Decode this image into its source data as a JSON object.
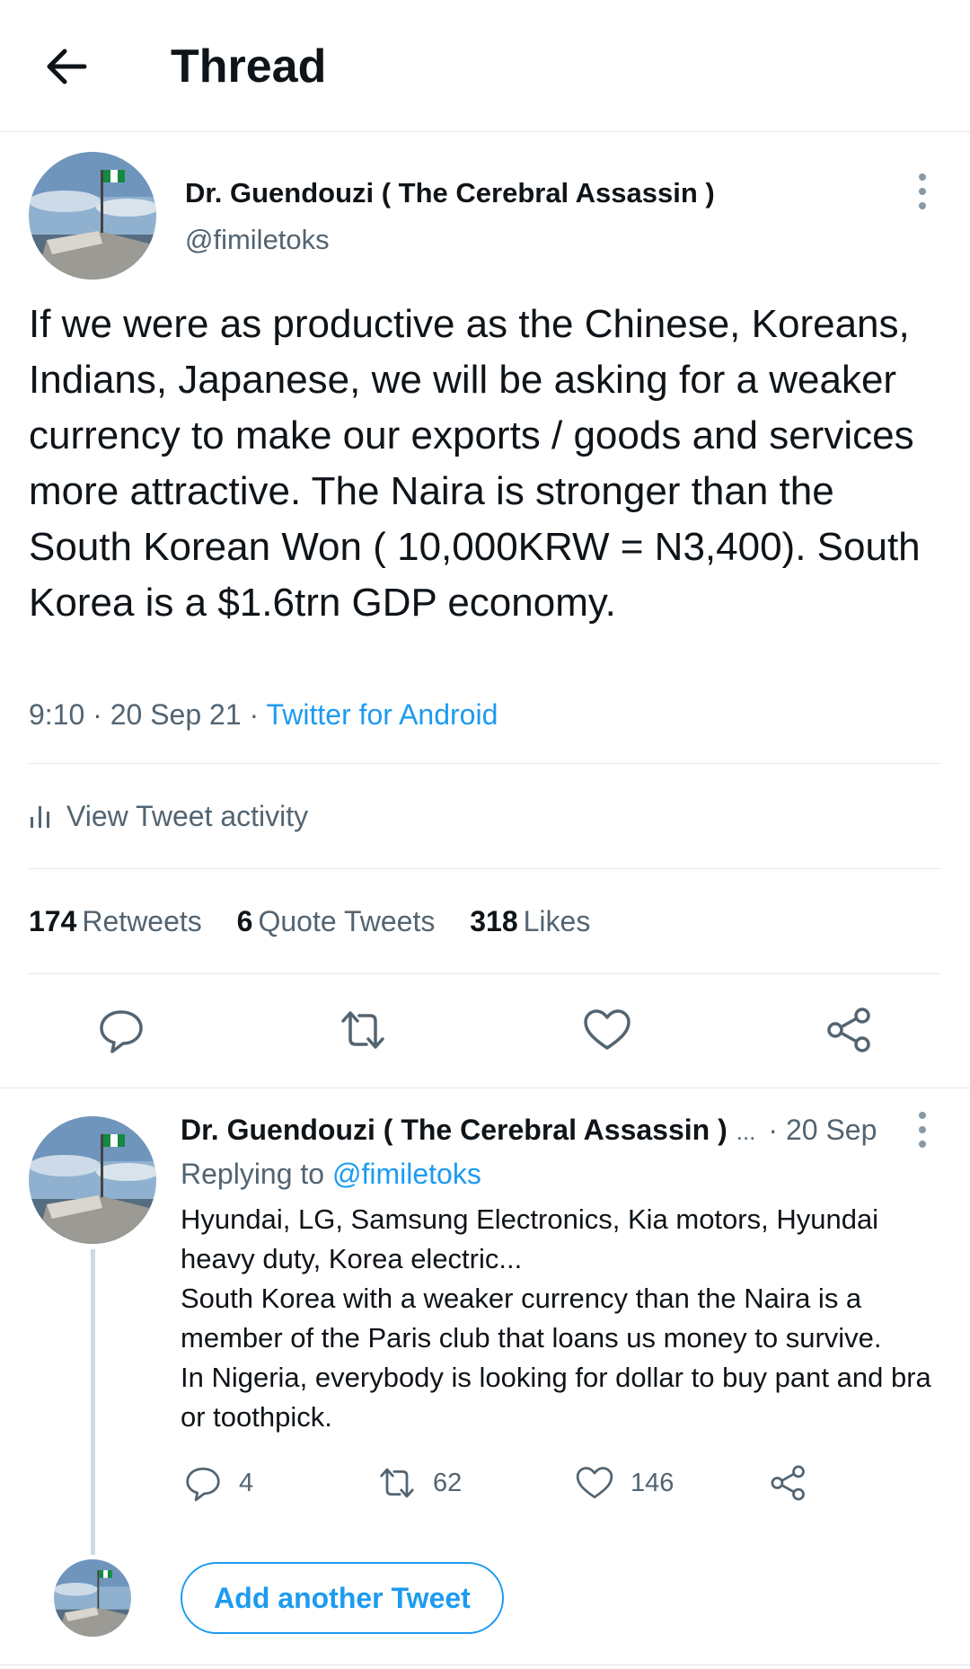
{
  "header": {
    "title": "Thread",
    "back_icon": "arrow-left-icon"
  },
  "colors": {
    "accent": "#1d9bf0",
    "secondary_text": "#536471",
    "primary_text": "#0f1419",
    "divider": "#e1e8ed"
  },
  "main_tweet": {
    "author_name": "Dr. Guendouzi ( The Cerebral Assassin )",
    "handle": "@fimiletoks",
    "text": "If we were as productive as the Chinese, Koreans, Indians, Japanese, we will be asking for a weaker currency to make our exports / goods and services more attractive. The Naira is stronger than the South Korean Won ( 10,000KRW = N3,400). South Korea is a $1.6trn GDP economy.",
    "time": "9:10",
    "date": "20 Sep 21",
    "separator": "·",
    "source": "Twitter for Android",
    "activity_label": "View Tweet activity",
    "stats": {
      "retweets_count": "174",
      "retweets_label": "Retweets",
      "quotes_count": "6",
      "quotes_label": "Quote Tweets",
      "likes_count": "318",
      "likes_label": "Likes"
    }
  },
  "reply": {
    "author_name": "Dr. Guendouzi ( The Cerebral Assassin )",
    "ellipsis": "...",
    "date": "· 20 Sep",
    "replying_prefix": "Replying to",
    "replying_to": "@fimiletoks",
    "lines": [
      "Hyundai, LG, Samsung Electronics, Kia motors, Hyundai heavy duty, Korea electric...",
      "South Korea with a weaker currency than the Naira is a member of the Paris club that loans us money to survive.",
      "In Nigeria, everybody is looking for dollar to buy pant and bra or toothpick."
    ],
    "reply_count": "4",
    "retweet_count": "62",
    "like_count": "146"
  },
  "compose": {
    "button_label": "Add another Tweet"
  }
}
